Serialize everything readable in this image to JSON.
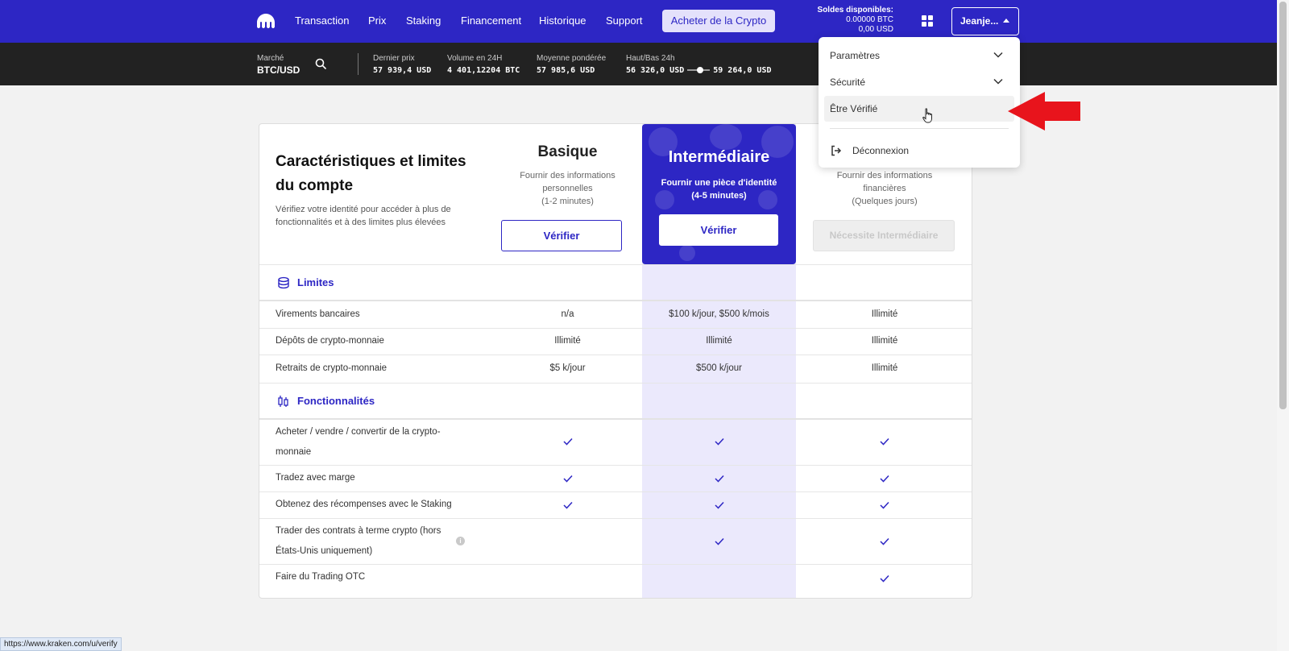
{
  "nav": {
    "items": [
      "Transaction",
      "Prix",
      "Staking",
      "Financement",
      "Historique",
      "Support"
    ],
    "buy_button": "Acheter de la Crypto",
    "balance_title": "Soldes disponibles:",
    "balance_btc": "0.00000 BTC",
    "balance_usd": "0,00 USD",
    "user_label": "Jeanje..."
  },
  "ticker": {
    "market_label": "Marché",
    "market_value": "BTC/USD",
    "last_price_label": "Dernier prix",
    "last_price_value": "57 939,4 USD",
    "volume_label": "Volume en 24H",
    "volume_value": "4 401,12204 BTC",
    "vwap_label": "Moyenne pondérée",
    "vwap_value": "57 985,6 USD",
    "range_label": "Haut/Bas 24h",
    "range_low": "56 326,0 USD",
    "range_high": "59 264,0 USD"
  },
  "card": {
    "title": "Caractéristiques et limites du compte",
    "subtitle": "Vérifiez votre identité pour accéder à plus de fonctionnalités et à des limites plus élevées"
  },
  "tiers": {
    "basic": {
      "name": "Basique",
      "desc_1": "Fournir des informations",
      "desc_2": "personnelles",
      "desc_3": "(1-2 minutes)",
      "button": "Vérifier"
    },
    "intermediate": {
      "name": "Intermédiaire",
      "desc_1": "Fournir une pièce d'identité",
      "desc_2": "(4-5 minutes)",
      "button": "Vérifier"
    },
    "advanced": {
      "desc_1": "Fournir des informations",
      "desc_2": "financières",
      "desc_3": "(Quelques jours)",
      "button": "Nécessite Intermédiaire"
    }
  },
  "sections": {
    "limits": "Limites",
    "features": "Fonctionnalités"
  },
  "limits_rows": [
    {
      "label": "Virements bancaires",
      "basic": "n/a",
      "intermediate": "$100 k/jour, $500 k/mois",
      "advanced": "Illimité"
    },
    {
      "label": "Dépôts de crypto-monnaie",
      "basic": "Illimité",
      "intermediate": "Illimité",
      "advanced": "Illimité"
    },
    {
      "label": "Retraits de crypto-monnaie",
      "basic": "$5 k/jour",
      "intermediate": "$500 k/jour",
      "advanced": "Illimité"
    }
  ],
  "feature_rows": [
    {
      "label_1": "Acheter / vendre / convertir de la crypto-",
      "label_2": "monnaie"
    },
    {
      "label": "Tradez avec marge"
    },
    {
      "label": "Obtenez des récompenses avec le Staking"
    },
    {
      "label_1": "Trader des contrats à terme crypto (hors",
      "label_2": "États-Unis uniquement)"
    },
    {
      "label": "Faire du Trading OTC"
    }
  ],
  "dropdown": {
    "settings": "Paramètres",
    "security": "Sécurité",
    "verify": "Être Vérifié",
    "logout": "Déconnexion"
  },
  "status_url": "https://www.kraken.com/u/verify",
  "colors": {
    "brand": "#2d26c4",
    "highlight_column": "#ebe9fc",
    "annotation_arrow": "#e8141c"
  }
}
